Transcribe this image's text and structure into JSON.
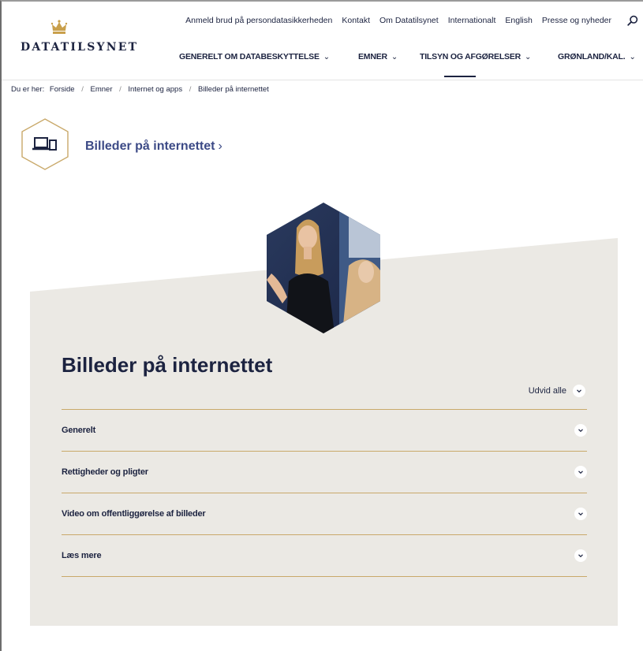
{
  "header": {
    "logo_text": "DATATILSYNET",
    "top_nav": [
      "Anmeld brud på persondatasikkerheden",
      "Kontakt",
      "Om Datatilsynet",
      "Internationalt",
      "English",
      "Presse og nyheder"
    ],
    "main_nav": [
      {
        "label": "GENERELT OM DATABESKYTTELSE",
        "chevron": "⌄"
      },
      {
        "label": "EMNER",
        "chevron": "⌄"
      },
      {
        "label": "TILSYN OG AFGØRELSER",
        "chevron": "⌄",
        "active": true
      },
      {
        "label": "GRØNLAND/KAL.",
        "chevron": "⌄"
      }
    ]
  },
  "breadcrumb": {
    "prefix": "Du er her:",
    "items": [
      "Forside",
      "Emner",
      "Internet og apps",
      "Billeder på internettet"
    ],
    "separator": "/"
  },
  "section": {
    "icon": "devices-icon",
    "title": "Billeder på internettet",
    "arrow": "›"
  },
  "main": {
    "title": "Billeder på internettet",
    "expand_all": "Udvid alle",
    "accordion": [
      {
        "label": "Generelt"
      },
      {
        "label": "Rettigheder og pligter"
      },
      {
        "label": "Video om offentliggørelse af billeder"
      },
      {
        "label": "Læs mere"
      }
    ]
  },
  "colors": {
    "navy": "#1c2340",
    "link_blue": "#3c4a86",
    "gold": "#c9a96a",
    "panel_beige": "#ebe9e4"
  }
}
